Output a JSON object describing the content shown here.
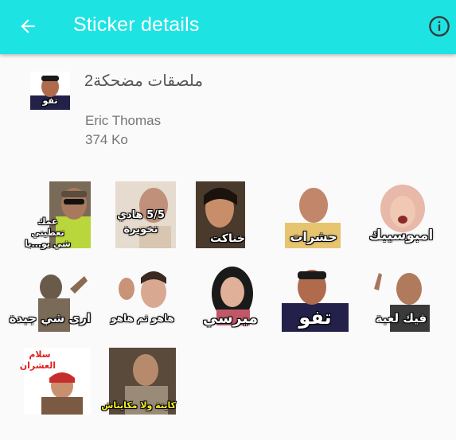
{
  "appbar": {
    "title": "Sticker details",
    "back_icon": "arrow-left-icon",
    "info_icon": "info-icon",
    "color": "#1ee3e3"
  },
  "pack": {
    "name": "ملصقات مضحكة2",
    "author": "Eric Thomas",
    "size": "374 Ko",
    "icon_caption": "تفو"
  },
  "stickers": [
    {
      "caption": "عمك تعطيني شي بو...با",
      "bg": "#7a6a58"
    },
    {
      "caption": "5/5 هادي تخويرة",
      "bg": "#d8c7b5"
    },
    {
      "caption": "خناكت",
      "bg": "#4a3a2c"
    },
    {
      "caption": "حشرات",
      "bg": "#c9c4bc"
    },
    {
      "caption": "امبوسيبك",
      "bg": "#e8d8d0"
    },
    {
      "caption": "ارى شي جبدة",
      "bg": "#6a5a4a"
    },
    {
      "caption": "هاهو ثم هاهو",
      "bg": "#d9cfc6"
    },
    {
      "caption": "ميرسي",
      "bg": "#2a2a2a"
    },
    {
      "caption": "تفو",
      "bg": "#2a2050"
    },
    {
      "caption": "فيك لعبة",
      "bg": "#3a3a3a"
    },
    {
      "caption": "سلام العشران",
      "bg": "#c82d2d"
    },
    {
      "caption": "كاينة ولا مكايناش",
      "bg": "#5a4a3c"
    }
  ]
}
